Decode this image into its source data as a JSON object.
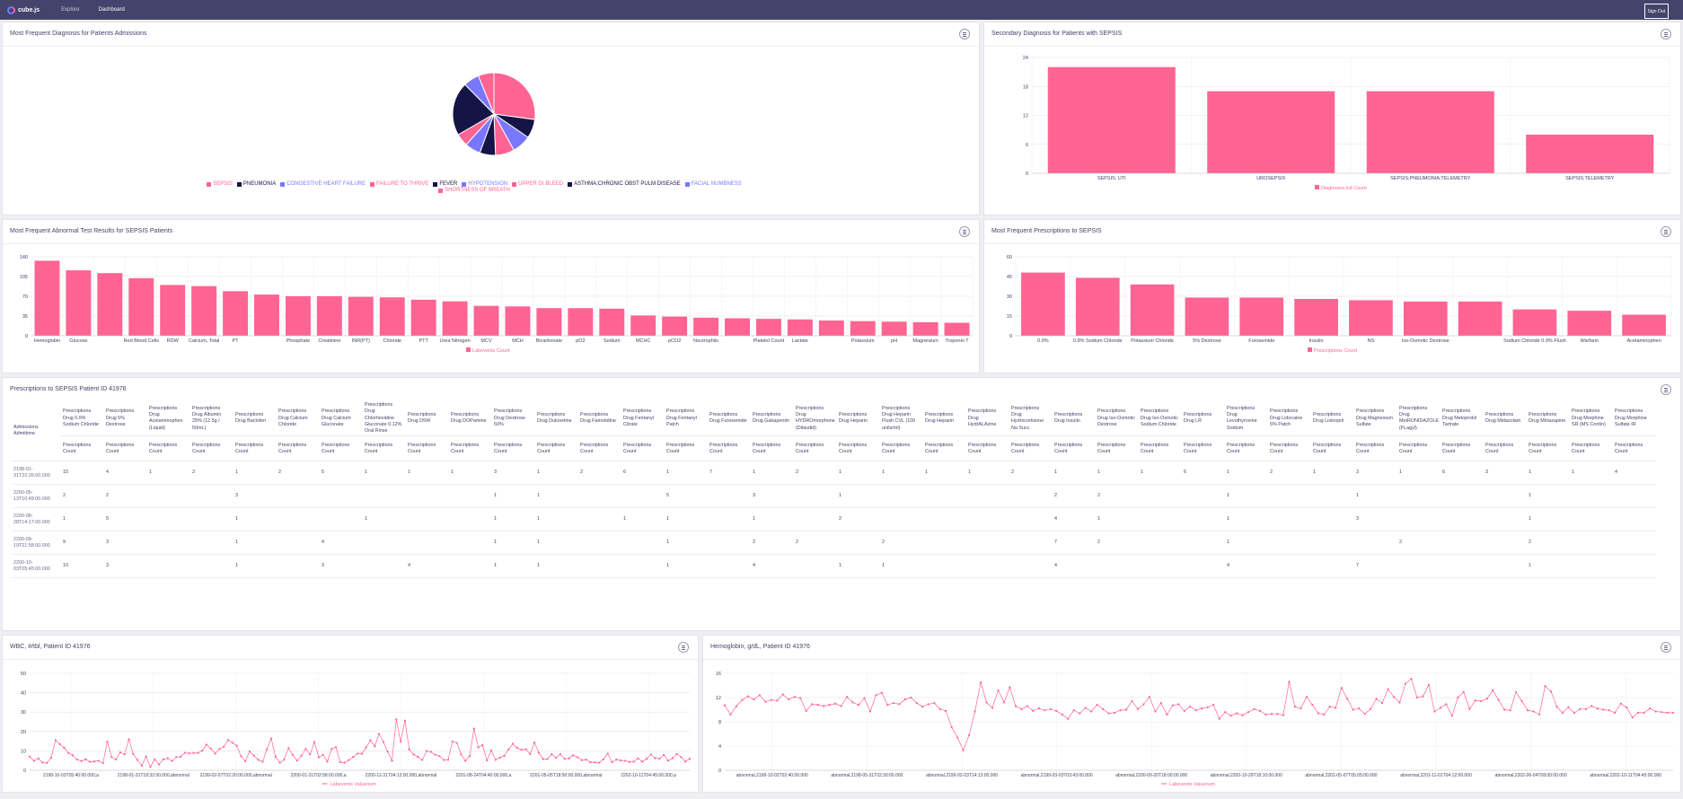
{
  "nav": {
    "logo": "cube.js",
    "links": [
      "Explore",
      "Dashboard"
    ],
    "active": "Dashboard",
    "signout": "Sign Out"
  },
  "colors": {
    "nav": "#43436b",
    "pink": "#ff6492",
    "navy": "#141446",
    "purple": "#7a77ff"
  },
  "cards": {
    "pie": {
      "title": "Most Frequent Diagnosis for Patients Admissions"
    },
    "secondary": {
      "title": "Secondary Diagnosis for Patients with SEPSIS"
    },
    "abnormal": {
      "title": "Most Frequent Abnormal Test Results for SEPSIS Patients"
    },
    "prescriptions": {
      "title": "Most Frequent Prescriptions to SEPSIS"
    },
    "table": {
      "title": "Prescriptions to SEPSIS Patient ID 41976"
    },
    "wbc": {
      "title": "WBC, #/tbl, Patient ID 41976"
    },
    "hgb": {
      "title": "Hemoglobin, g/dL, Patient ID 41976"
    }
  },
  "chart_data": [
    {
      "id": "pie",
      "type": "pie",
      "legend_position": "bottom",
      "categories": [
        "SEPSIS",
        "PNEUMONIA",
        "CONGESTIVE HEART FAILURE",
        "FAILURE TO THRIVE",
        "FEVER",
        "HYPOTENSION",
        "UPPER GI BLEED",
        "ASTHMA;CHRONIC OBST PULM DISEASE",
        "FACIAL NUMBNESS",
        "SHORTNESS OF BREATH"
      ],
      "colors": [
        "#ff6492",
        "#141446",
        "#7a77ff",
        "#ff6492",
        "#141446",
        "#7a77ff",
        "#ff6492",
        "#141446",
        "#7a77ff",
        "#ff6492"
      ],
      "values": [
        22,
        6,
        6,
        6,
        5,
        5,
        4,
        17,
        5,
        5
      ]
    },
    {
      "id": "secondary",
      "type": "bar",
      "categories": [
        "SEPSIS; UTI",
        "UROSEPSIS",
        "SEPSIS;PNEUMONIA;TELEMETRY",
        "SEPSIS;TELEMETRY"
      ],
      "series": [
        {
          "name": "Diagnoses.icd Count",
          "values": [
            22,
            17,
            17,
            8
          ]
        }
      ],
      "ylim": [
        0,
        24
      ],
      "yticks": [
        0,
        6,
        12,
        18,
        24
      ],
      "color": "#ff6492",
      "legend_position": "bottom"
    },
    {
      "id": "abnormal",
      "type": "bar",
      "categories": [
        "Hemoglobin",
        "Glucose",
        "",
        "Red Blood Cells",
        "RDW",
        "Calcium, Total",
        "PT",
        "",
        "Phosphate",
        "Creatinine",
        "INR(PT)",
        "Chloride",
        "PTT",
        "Urea Nitrogen",
        "MCV",
        "MCH",
        "Bicarbonate",
        "pO2",
        "Sodium",
        "MCHC",
        "pCO2",
        "Neutrophils",
        "",
        "Platelet Count",
        "Lactate",
        "",
        "Potassium",
        "pH",
        "Magnesium",
        "Troponin T"
      ],
      "series": [
        {
          "name": "Labevents Count",
          "values": [
            133,
            116,
            111,
            102,
            90,
            88,
            79,
            73,
            70,
            70,
            69,
            68,
            64,
            61,
            53,
            52,
            49,
            49,
            48,
            36,
            34,
            32,
            31,
            30,
            29,
            27,
            26,
            25,
            24,
            23
          ]
        }
      ],
      "ylim": [
        0,
        140
      ],
      "yticks": [
        0,
        35,
        70,
        105,
        140
      ],
      "color": "#ff6492",
      "legend_position": "bottom"
    },
    {
      "id": "prescriptions",
      "type": "bar",
      "categories": [
        "0.9%",
        "0.9% Sodium Chloride",
        "Potassium Chloride",
        "5% Dextrose",
        "Furosemide",
        "Insulin",
        "NS",
        "Iso-Osmotic Dextrose",
        "",
        "Sodium Chloride 0.9% Flush",
        "Warfarin",
        "Acetaminophen"
      ],
      "series": [
        {
          "name": "Prescriptions Count",
          "values": [
            48,
            44,
            39,
            29,
            29,
            28,
            27,
            26,
            26,
            20,
            19,
            16
          ]
        }
      ],
      "ylim": [
        0,
        60
      ],
      "yticks": [
        0,
        15,
        30,
        45,
        60
      ],
      "color": "#ff6492",
      "legend_position": "bottom"
    },
    {
      "id": "wbc",
      "type": "line",
      "series": [
        {
          "name": "Labevents Valuenum",
          "values": [
            7.1,
            4.9,
            6.1,
            4.0,
            3.8,
            6.5,
            15.5,
            13.5,
            11.6,
            8.9,
            7.7,
            5.5,
            4.8,
            5.6,
            4.4,
            4.6,
            4.9,
            3.7,
            14.7,
            6.8,
            5.6,
            9.2,
            8.2,
            16.0,
            8.4,
            5.4,
            2.4,
            7.1,
            1.8,
            5.6,
            3.0,
            5.6,
            6.2,
            4.8,
            6.8,
            7.0,
            9.0,
            8.7,
            8.9,
            8.9,
            10.1,
            13.2,
            11.2,
            8.6,
            11.0,
            12.1,
            15.6,
            14.2,
            12.7,
            7.3,
            4.7,
            9.7,
            7.6,
            5.4,
            4.4,
            10.8,
            16.4,
            6.9,
            3.9,
            5.5,
            11.4,
            8.0,
            5.0,
            7.5,
            11.0,
            8.2,
            14.6,
            6.7,
            7.9,
            4.5,
            11.0,
            11.9,
            4.2,
            3.9,
            5.3,
            6.9,
            8.6,
            8.5,
            11.8,
            15.4,
            12.4,
            18.7,
            14.6,
            9.6,
            4.9,
            26.3,
            14.7,
            25.6,
            10.7,
            8.2,
            6.9,
            5.3,
            9.9,
            9.5,
            8.0,
            7.3,
            5.3,
            5.4,
            14.9,
            14.1,
            8.2,
            4.9,
            7.3,
            21.5,
            11.8,
            12.9,
            5.1,
            10.2,
            5.4,
            6.5,
            7.4,
            10.7,
            13.7,
            11.5,
            10.6,
            10.9,
            8.4,
            14.3,
            9.1,
            5.8,
            5.8,
            8.3,
            6.4,
            8.3,
            5.9,
            6.1,
            7.7,
            6.7,
            5.2,
            5.5,
            4.1,
            4.1,
            3.9,
            5.7,
            8.6,
            4.2,
            5.5,
            5.1,
            4.9,
            4.3,
            4.4,
            6.1,
            4.5,
            5.9,
            8.2,
            6.2,
            6.0,
            7.9,
            5.0,
            6.2,
            8.4,
            6.8,
            4.5,
            5.9
          ]
        }
      ],
      "x_labels": [
        "2198-10-03T05:40:00.000,a",
        "2198-01-31T18:32:00.000,abnormal",
        "2199-02-07T02:20:00.000,abnormal",
        "2200-01-31T02:58:00.000,a",
        "2200-11-31T04:12:00.000,abnormal",
        "2201-08-24T04:40:00.000,a",
        "2201-05-05T18:50:00.000,abnormal",
        "2202-10-11T04:45:00.000,a"
      ],
      "ylim": [
        0,
        50
      ],
      "yticks": [
        0,
        10,
        20,
        30,
        40,
        50
      ],
      "color": "#ff6492",
      "legend_position": "bottom"
    },
    {
      "id": "hgb",
      "type": "line",
      "series": [
        {
          "name": "Labevents Valuenum",
          "values": [
            10.7,
            9.2,
            10.6,
            11.6,
            12.2,
            11.7,
            12.4,
            11.3,
            11.6,
            11.5,
            12.5,
            11.7,
            12.1,
            11.9,
            9.8,
            10.9,
            10.8,
            10.6,
            10.8,
            11.0,
            10.6,
            12.1,
            11.2,
            10.8,
            11.9,
            9.7,
            12.4,
            12.8,
            10.8,
            11.1,
            10.9,
            11.7,
            12.0,
            11.1,
            10.5,
            10.9,
            11.1,
            10.1,
            9.8,
            7.1,
            5.4,
            3.3,
            5.8,
            9.7,
            14.5,
            11.2,
            10.3,
            13.2,
            11.2,
            13.7,
            10.6,
            10.1,
            10.6,
            9.8,
            10.2,
            9.9,
            10.1,
            9.8,
            9.2,
            8.5,
            9.9,
            9.4,
            10.3,
            9.7,
            10.8,
            10.1,
            9.4,
            9.5,
            9.9,
            10.0,
            11.4,
            10.1,
            10.9,
            12.1,
            9.7,
            11.1,
            9.2,
            10.7,
            10.9,
            9.8,
            10.5,
            9.9,
            10.2,
            10.4,
            10.8,
            8.5,
            9.6,
            9.0,
            9.4,
            9.1,
            9.6,
            10.1,
            9.8,
            9.2,
            9.3,
            9.3,
            9.1,
            14.6,
            10.5,
            10.2,
            12.1,
            10.8,
            9.4,
            9.2,
            10.5,
            10.3,
            13.6,
            11.8,
            10.0,
            10.2,
            9.3,
            10.1,
            11.8,
            11.1,
            13.4,
            12.1,
            11.2,
            14.3,
            15.1,
            12.0,
            12.2,
            14.1,
            9.7,
            10.3,
            10.9,
            9.0,
            12.0,
            12.9,
            10.1,
            11.5,
            11.4,
            11.8,
            13.2,
            11.6,
            10.0,
            9.9,
            12.9,
            11.4,
            9.9,
            9.7,
            9.2,
            13.9,
            13.0,
            10.5,
            9.5,
            10.4,
            9.5,
            10.1,
            10.1,
            10.6,
            10.2,
            10.0,
            9.9,
            9.5,
            11.0,
            10.4,
            8.7,
            9.5,
            9.5,
            10.2,
            9.7,
            9.6,
            9.5,
            9.5
          ]
        }
      ],
      "x_labels": [
        "abnormal,2198-10-03T02:40:00.000",
        "abnormal,2198-05-31T02:30:00.000",
        "abnormal,2199-02-03T14:13:00.000",
        "abnormal,2199-03-03T03:43:00.000",
        "abnormal,2200-09-20T18:00:00.000",
        "abnormal,2200-10-29T18:10:00.000",
        "abnormal,2201-05-07T05:05:00.000",
        "abnormal,2201-11-01T04:12:00.000",
        "abnormal,2202-06-04T08:00:00.000",
        "abnormal,2202-10-11T04:45:00.000"
      ],
      "ylim": [
        0,
        16
      ],
      "yticks": [
        0,
        4,
        8,
        12,
        16
      ],
      "color": "#ff6492",
      "legend_position": "bottom"
    }
  ],
  "table": {
    "row_header": "Admissions Admittime",
    "columns": [
      "Prescriptions Drug 0.9% Sodium Chloride",
      "Prescriptions Drug 5% Dextrose",
      "Prescriptions Drug Acetaminophen (Liquid)",
      "Prescriptions Drug Albumin 25% (12.5g / 50mL)",
      "Prescriptions Drug Baclofen",
      "Prescriptions Drug Calcium Chloride",
      "Prescriptions Drug Calcium Gluconate",
      "Prescriptions Drug Chlorhexidine Gluconate 0.12% Oral Rinse",
      "Prescriptions Drug D5W",
      "Prescriptions Drug DOPamine",
      "Prescriptions Drug Dextrose 50%",
      "Prescriptions Drug Duloxetine",
      "Prescriptions Drug Famotidine",
      "Prescriptions Drug Fentanyl Citrate",
      "Prescriptions Drug Fentanyl Patch",
      "Prescriptions Drug Furosemide",
      "Prescriptions Drug Gabapentin",
      "Prescriptions Drug HYDROmorphone (Dilaudid)",
      "Prescriptions Drug Heparin",
      "Prescriptions Drug Heparin Flush CVL (100 units/ml)",
      "Prescriptions Drug Heparin",
      "Prescriptions Drug HydrALAzine",
      "Prescriptions Drug Hydrocortisone Na Succ.",
      "Prescriptions Drug Insulin",
      "Prescriptions Drug Iso-Osmotic Dextrose",
      "Prescriptions Drug Iso-Osmotic Sodium Chloride",
      "Prescriptions Drug LR",
      "Prescriptions Drug Levothyroxine Sodium",
      "Prescriptions Drug Lidocaine 5% Patch",
      "Prescriptions Drug Lisinopril",
      "Prescriptions Drug Magnesium Sulfate",
      "Prescriptions Drug MetRONIDAZOLE (FLagyl)",
      "Prescriptions Drug Metoprolol Tartrate",
      "Prescriptions Drug Midazolam",
      "Prescriptions Drug Mirtazapine",
      "Prescriptions Drug Morphine SR (MS Contin)",
      "Prescriptions Drug Morphine Sulfate IR"
    ],
    "sub_header": "Prescriptions Count",
    "rows": [
      {
        "time": "2198-01-31T22:26:00.000",
        "vals": [
          "15",
          "4",
          "1",
          "2",
          "1",
          "2",
          "5",
          "1",
          "1",
          "1",
          "3",
          "1",
          "2",
          "6",
          "1",
          "7",
          "1",
          "2",
          "1",
          "1",
          "1",
          "1",
          "2",
          "1",
          "1",
          "1",
          "6",
          "1",
          "2",
          "1",
          "3",
          "1",
          "6",
          "3",
          "1",
          "1",
          "4"
        ]
      },
      {
        "time": "2200-05-13T10:49:00.000",
        "vals": [
          "2",
          "2",
          "",
          "",
          "3",
          "",
          "",
          "",
          "",
          "",
          "1",
          "1",
          "",
          "",
          "5",
          "",
          "3",
          "",
          "1",
          "",
          "",
          "",
          "",
          "2",
          "2",
          "",
          "",
          "1",
          "",
          "",
          "1",
          "",
          "",
          "",
          "1",
          "",
          ""
        ]
      },
      {
        "time": "2200-08-28T14:17:00.000",
        "vals": [
          "1",
          "5",
          "",
          "",
          "1",
          "",
          "",
          "1",
          "",
          "",
          "1",
          "1",
          "",
          "1",
          "1",
          "",
          "1",
          "",
          "2",
          "",
          "",
          "",
          "",
          "4",
          "1",
          "",
          "",
          "1",
          "",
          "",
          "3",
          "",
          "",
          "",
          "1",
          "",
          ""
        ]
      },
      {
        "time": "2200-09-19T21:58:00.000",
        "vals": [
          "9",
          "3",
          "",
          "",
          "1",
          "",
          "4",
          "",
          "",
          "",
          "1",
          "1",
          "",
          "",
          "1",
          "",
          "2",
          "2",
          "",
          "2",
          "",
          "",
          "",
          "7",
          "2",
          "",
          "",
          "1",
          "",
          "",
          "",
          "2",
          "",
          "",
          "2",
          "",
          ""
        ]
      },
      {
        "time": "2200-10-03T05:45:00.000",
        "vals": [
          "10",
          "3",
          "",
          "",
          "1",
          "",
          "3",
          "",
          "4",
          "",
          "1",
          "1",
          "",
          "",
          "1",
          "",
          "4",
          "",
          "1",
          "1",
          "",
          "",
          "",
          "4",
          "",
          "",
          "",
          "4",
          "",
          "",
          "7",
          "",
          "",
          "",
          "1",
          "",
          ""
        ]
      }
    ]
  }
}
